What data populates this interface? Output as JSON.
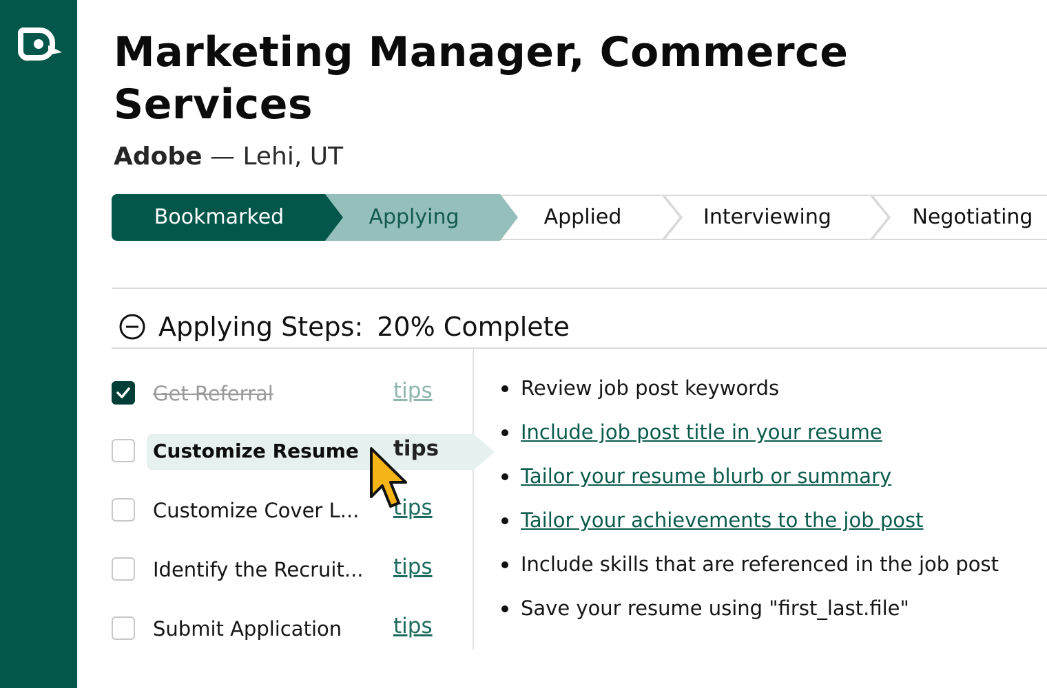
{
  "brand": {
    "color": "#03574a",
    "logo_icon": "speech-bubble-logo"
  },
  "job": {
    "title": "Marketing Manager, Commerce Services",
    "company": "Adobe",
    "separator": "—",
    "location": "Lehi, UT"
  },
  "pipeline": {
    "stages": [
      {
        "label": "Bookmarked",
        "state": "complete"
      },
      {
        "label": "Applying",
        "state": "current"
      },
      {
        "label": "Applied",
        "state": "upcoming"
      },
      {
        "label": "Interviewing",
        "state": "upcoming"
      },
      {
        "label": "Negotiating",
        "state": "upcoming"
      }
    ],
    "colors": {
      "complete": "#03574a",
      "current": "#95bfba",
      "upcoming": "#ffffff"
    }
  },
  "steps": {
    "title": "Applying Steps:",
    "progress_text": "20% Complete",
    "progress_fraction": 0.2,
    "items": [
      {
        "label": "Get Referral",
        "tips": "tips",
        "checked": true
      },
      {
        "label": "Customize Resume",
        "tips": "tips",
        "checked": false,
        "active": true
      },
      {
        "label": "Customize Cover L...",
        "tips": "tips",
        "checked": false
      },
      {
        "label": "Identify the Recruit...",
        "tips": "tips",
        "checked": false
      },
      {
        "label": "Submit Application",
        "tips": "tips",
        "checked": false
      }
    ]
  },
  "tips_panel": {
    "items": [
      {
        "text": "Review job post keywords",
        "link": false
      },
      {
        "text": "Include job post title in your resume",
        "link": true
      },
      {
        "text": "Tailor your resume blurb or summary",
        "link": true
      },
      {
        "text": "Tailor your achievements to the job post",
        "link": true
      },
      {
        "text": "Include skills that are referenced in the job post",
        "link": false
      },
      {
        "text": "Save your resume using \"first_last.file\"",
        "link": false
      }
    ]
  }
}
